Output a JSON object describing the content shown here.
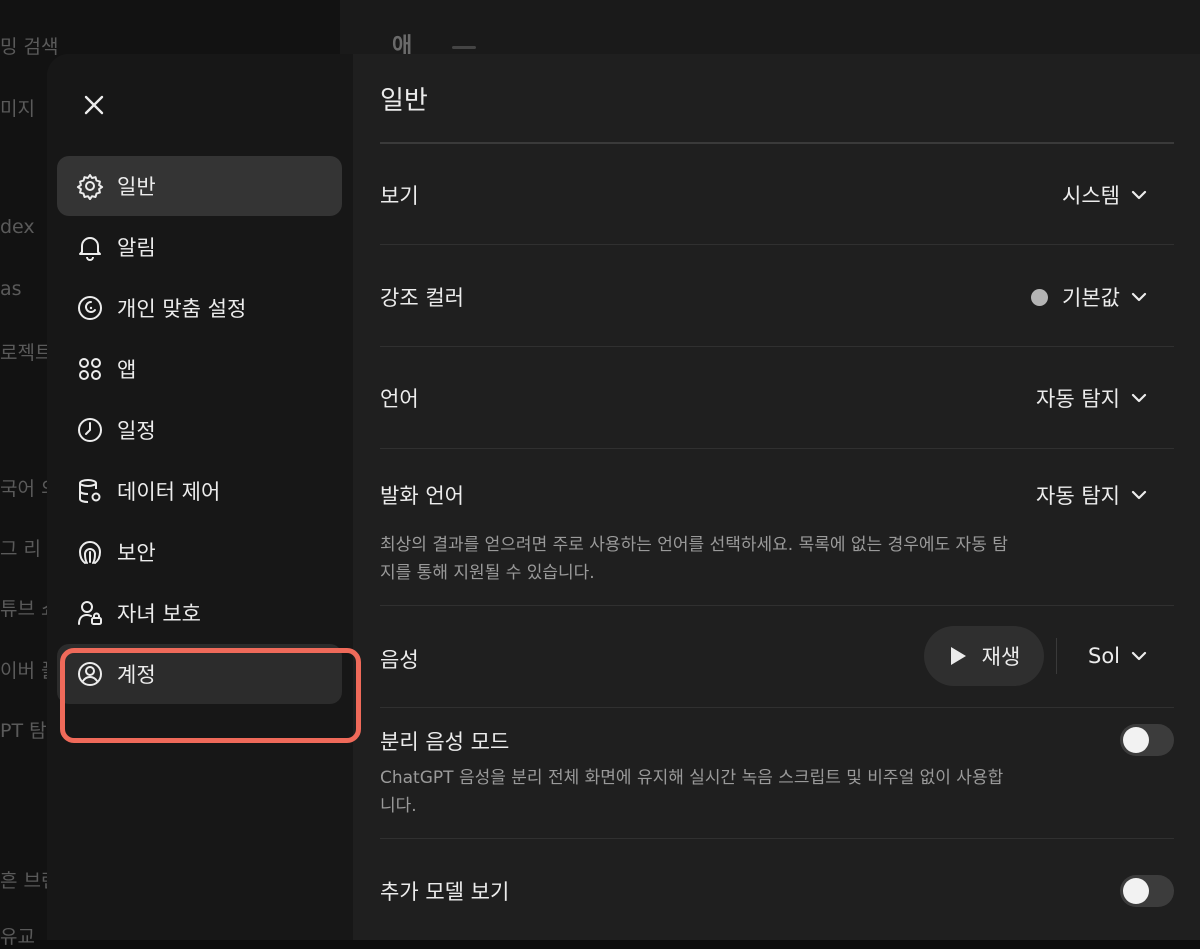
{
  "background": {
    "sidebar_fragments": [
      "밍 검색",
      "미지",
      "dex",
      "as",
      "로젝트",
      "국어 의",
      "그 리",
      "튜브 쇼",
      "이버 플",
      "PT 탐",
      "흔 브랜",
      "유교"
    ],
    "heading": "애"
  },
  "nav": {
    "close_label": "✕",
    "items": [
      {
        "label": "일반",
        "icon": "gear-icon"
      },
      {
        "label": "알림",
        "icon": "bell-icon"
      },
      {
        "label": "개인 맞춤 설정",
        "icon": "personalization-icon"
      },
      {
        "label": "앱",
        "icon": "apps-grid-icon"
      },
      {
        "label": "일정",
        "icon": "clock-icon"
      },
      {
        "label": "데이터 제어",
        "icon": "database-gear-icon"
      },
      {
        "label": "보안",
        "icon": "security-icon"
      },
      {
        "label": "자녀 보호",
        "icon": "parental-control-icon"
      },
      {
        "label": "계정",
        "icon": "account-circle-icon"
      }
    ]
  },
  "content": {
    "title": "일반",
    "appearance": {
      "label": "보기",
      "value": "시스템"
    },
    "accent": {
      "label": "강조 컬러",
      "value": "기본값",
      "dot_color": "#b4b4b4"
    },
    "language": {
      "label": "언어",
      "value": "자동 탐지"
    },
    "spoken_language": {
      "label": "발화 언어",
      "value": "자동 탐지",
      "desc_line1": "최상의 결과를 얻으려면 주로 사용하는 언어를 선택하세요. 목록에 없는 경우에도 자동 탐",
      "desc_line2": "지를 통해 지원될 수 있습니다."
    },
    "voice": {
      "label": "음성",
      "play_label": "재생",
      "value": "Sol"
    },
    "separate_voice": {
      "label": "분리 음성 모드",
      "desc_line1": "ChatGPT 음성을 분리 전체 화면에 유지해 실시간 녹음 스크립트 및 비주얼 없이 사용합",
      "desc_line2": "니다.",
      "enabled": false
    },
    "more_models": {
      "label": "추가 모델 보기",
      "enabled": false
    }
  },
  "colors": {
    "highlight": "#ef6a5a",
    "modal_bg": "#1f1f1f",
    "nav_bg": "#171717"
  }
}
